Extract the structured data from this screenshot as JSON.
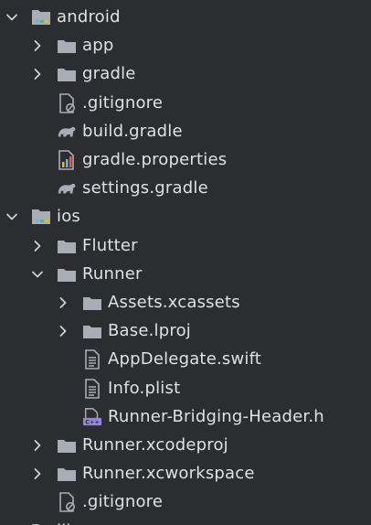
{
  "tree": [
    {
      "label": "android",
      "kind": "module-folder",
      "depth": 0,
      "chevron": "expanded"
    },
    {
      "label": "app",
      "kind": "folder",
      "depth": 1,
      "chevron": "collapsed"
    },
    {
      "label": "gradle",
      "kind": "folder",
      "depth": 1,
      "chevron": "collapsed"
    },
    {
      "label": ".gitignore",
      "kind": "gitignore-file",
      "depth": 1,
      "chevron": "none"
    },
    {
      "label": "build.gradle",
      "kind": "gradle-file",
      "depth": 1,
      "chevron": "none"
    },
    {
      "label": "gradle.properties",
      "kind": "properties-file",
      "depth": 1,
      "chevron": "none"
    },
    {
      "label": "settings.gradle",
      "kind": "gradle-file",
      "depth": 1,
      "chevron": "none"
    },
    {
      "label": "ios",
      "kind": "module-folder",
      "depth": 0,
      "chevron": "expanded"
    },
    {
      "label": "Flutter",
      "kind": "folder",
      "depth": 1,
      "chevron": "collapsed"
    },
    {
      "label": "Runner",
      "kind": "folder",
      "depth": 1,
      "chevron": "expanded"
    },
    {
      "label": "Assets.xcassets",
      "kind": "folder",
      "depth": 2,
      "chevron": "collapsed"
    },
    {
      "label": "Base.lproj",
      "kind": "folder",
      "depth": 2,
      "chevron": "collapsed"
    },
    {
      "label": "AppDelegate.swift",
      "kind": "text-file",
      "depth": 2,
      "chevron": "none"
    },
    {
      "label": "Info.plist",
      "kind": "text-file",
      "depth": 2,
      "chevron": "none"
    },
    {
      "label": "Runner-Bridging-Header.h",
      "kind": "cpp-header-file",
      "depth": 2,
      "chevron": "none"
    },
    {
      "label": "Runner.xcodeproj",
      "kind": "folder",
      "depth": 1,
      "chevron": "collapsed"
    },
    {
      "label": "Runner.xcworkspace",
      "kind": "folder",
      "depth": 1,
      "chevron": "collapsed"
    },
    {
      "label": ".gitignore",
      "kind": "gitignore-file",
      "depth": 1,
      "chevron": "none"
    },
    {
      "label": "lib",
      "kind": "module-folder",
      "depth": 0,
      "chevron": "expanded"
    }
  ],
  "colors": {
    "background": "#2b2d30",
    "text": "#dfe1e5",
    "chevron": "#ced0d6",
    "folder": "#a9adb5",
    "module_marker": "#6fb1e8",
    "module_marker_green": "#5fb865",
    "module_marker_yellow": "#e0b64a",
    "gradle": "#a9adb5",
    "cpp_badge": "#9a86d6"
  }
}
